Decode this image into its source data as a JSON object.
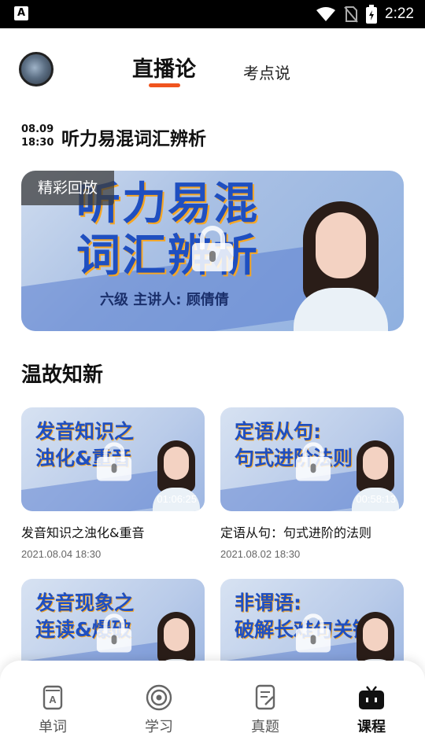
{
  "status_bar": {
    "time": "2:22",
    "left_icon": "A"
  },
  "header": {
    "tabs": [
      {
        "label": "直播论",
        "active": true
      },
      {
        "label": "考点说",
        "active": false
      }
    ]
  },
  "live": {
    "date": "08.09",
    "time": "18:30",
    "title": "听力易混词汇辨析",
    "replay_tag": "精彩回放",
    "banner_text_line1": "听力易混",
    "banner_text_line2": "词汇辨析",
    "banner_sub": "六级  主讲人: 顾倩倩"
  },
  "review": {
    "title": "温故知新",
    "items": [
      {
        "thumb_line1": "发音知识之",
        "thumb_line2": "浊化&重音",
        "duration": "01:06:25",
        "title": "发音知识之浊化&重音",
        "date": "2021.08.04 18:30"
      },
      {
        "thumb_line1": "定语从句:",
        "thumb_line2": "句式进阶法则",
        "duration": "00:58:13",
        "title": "定语从句：句式进阶的法则",
        "date": "2021.08.02 18:30"
      },
      {
        "thumb_line1": "发音现象之",
        "thumb_line2": "连读&爆破"
      },
      {
        "thumb_line1": "非谓语:",
        "thumb_line2": "破解长难句关键"
      }
    ]
  },
  "nav": {
    "items": [
      {
        "label": "单词",
        "icon": "word-book-icon"
      },
      {
        "label": "学习",
        "icon": "target-icon"
      },
      {
        "label": "真题",
        "icon": "exam-paper-icon"
      },
      {
        "label": "课程",
        "icon": "tv-icon",
        "active": true
      }
    ]
  },
  "colors": {
    "accent": "#f0541e",
    "banner_blue": "#1f4fc0"
  }
}
